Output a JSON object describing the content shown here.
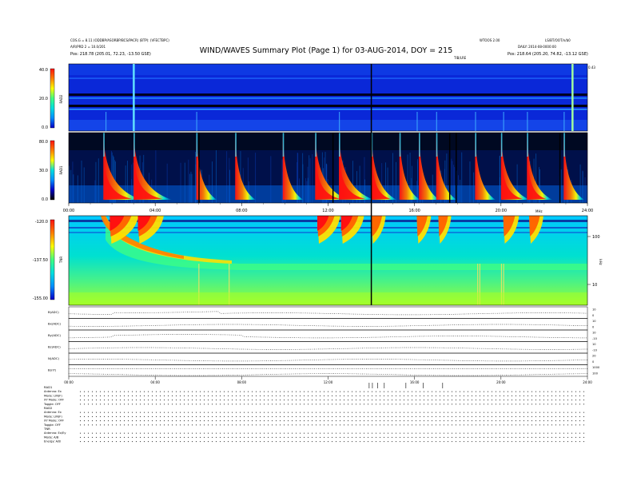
{
  "header": {
    "left": [
      "COS.G = 8.11 (ODDBP/ASORBP/BCS/PACR) (BTP): (VFECTBPC)",
      "A/R/PRD 2 = 10.0/201",
      "Pos:  218.78 (205.01, 72.23, -13.50 GSE)"
    ],
    "right": [
      "WTOOS 2.00",
      "LS/BT/OOT/n/b0",
      "DAILY: 2014-08-0000:00",
      "Pos:  218.64 (205.20, 74.82, -13.12 GSE)"
    ],
    "title": "WIND/WAVES Summary Plot (Page 1) for 03-AUG-2014, DOY = 215",
    "top_annot": "TIB/LRE",
    "top_right_mark": "0.43"
  },
  "chart_data": [
    {
      "type": "heatmap",
      "panel": "RAD2",
      "ylabel": "RAD2",
      "yticks": [
        "40.0",
        "20.0",
        "0.0"
      ],
      "ylim": [
        0,
        40
      ],
      "colorscale": [
        "#0000c8",
        "#0090ff",
        "#00e0e0",
        "#40ff80",
        "#ffff00",
        "#ff8000",
        "#ff1010"
      ]
    },
    {
      "type": "heatmap",
      "panel": "RAD1",
      "ylabel": "RAD1",
      "yticks": [
        "80.0",
        "30.0",
        "0.0"
      ],
      "ylim": [
        0,
        80
      ],
      "colorscale": [
        "#000000",
        "#0000c8",
        "#0090ff",
        "#00e0e0",
        "#ffff00",
        "#ff8000",
        "#ff1010"
      ],
      "bursts_hour": [
        1.6,
        3.0,
        5.9,
        7.7,
        9.9,
        11.4,
        12.5,
        14.0,
        15.3,
        16.2,
        17.0,
        18.8,
        20.0,
        21.2,
        22.9
      ]
    },
    {
      "type": "heatmap",
      "panel": "TNR",
      "ylabel": "TNR",
      "yticks": [
        "-120.0",
        "-137.50",
        "-155.00"
      ],
      "ylim": [
        -155,
        -120
      ],
      "right_ticks": [
        "100",
        "10"
      ],
      "right_label": "kHz",
      "colorscale": [
        "#0000c8",
        "#0090ff",
        "#00e0e0",
        "#40ff80",
        "#ffff00",
        "#ff8000",
        "#ff1010"
      ]
    },
    {
      "type": "line",
      "panel": "MFI",
      "rows": [
        {
          "label": "B(ADC)",
          "right_ticks": [
            "10",
            "0"
          ]
        },
        {
          "label": "Bx(ADC)",
          "right_ticks": [
            "10",
            "0"
          ]
        },
        {
          "label": "By(ADC)",
          "right_ticks": [
            "10",
            "-10"
          ]
        },
        {
          "label": "Bz(ADC)",
          "right_ticks": [
            "10",
            "-10"
          ]
        },
        {
          "label": "N(ADC)",
          "right_ticks": [
            "20",
            "0"
          ]
        },
        {
          "label": "B(nT)",
          "right_ticks": [
            "1000",
            "100"
          ]
        }
      ]
    }
  ],
  "x_axis": {
    "ticks": [
      "00:00",
      "04:00",
      "08:00",
      "12:00",
      "16:00",
      "20:00",
      "24:00"
    ],
    "xlim": [
      0,
      24
    ],
    "unit": "hours",
    "right_unit_label": "MHz"
  },
  "vertical_marker_hour": 14.0,
  "footer": {
    "groups": [
      {
        "title": "RAD1",
        "lines": [
          "Antenna:  Ex",
          "Mode:  LIN(F)",
          "XY Mode:  OFF",
          "Toggle:  OFF"
        ]
      },
      {
        "title": "RAD2",
        "lines": [
          "Antenna:  Ex",
          "Mode:  LIN(F)",
          "XY Mode:  OFF",
          "Toggle:  OFF"
        ]
      },
      {
        "title": "TNR",
        "lines": [
          "Antenna:  Ex/Ey",
          "Mode:  A/B",
          "Energy:  A/B"
        ]
      }
    ]
  }
}
